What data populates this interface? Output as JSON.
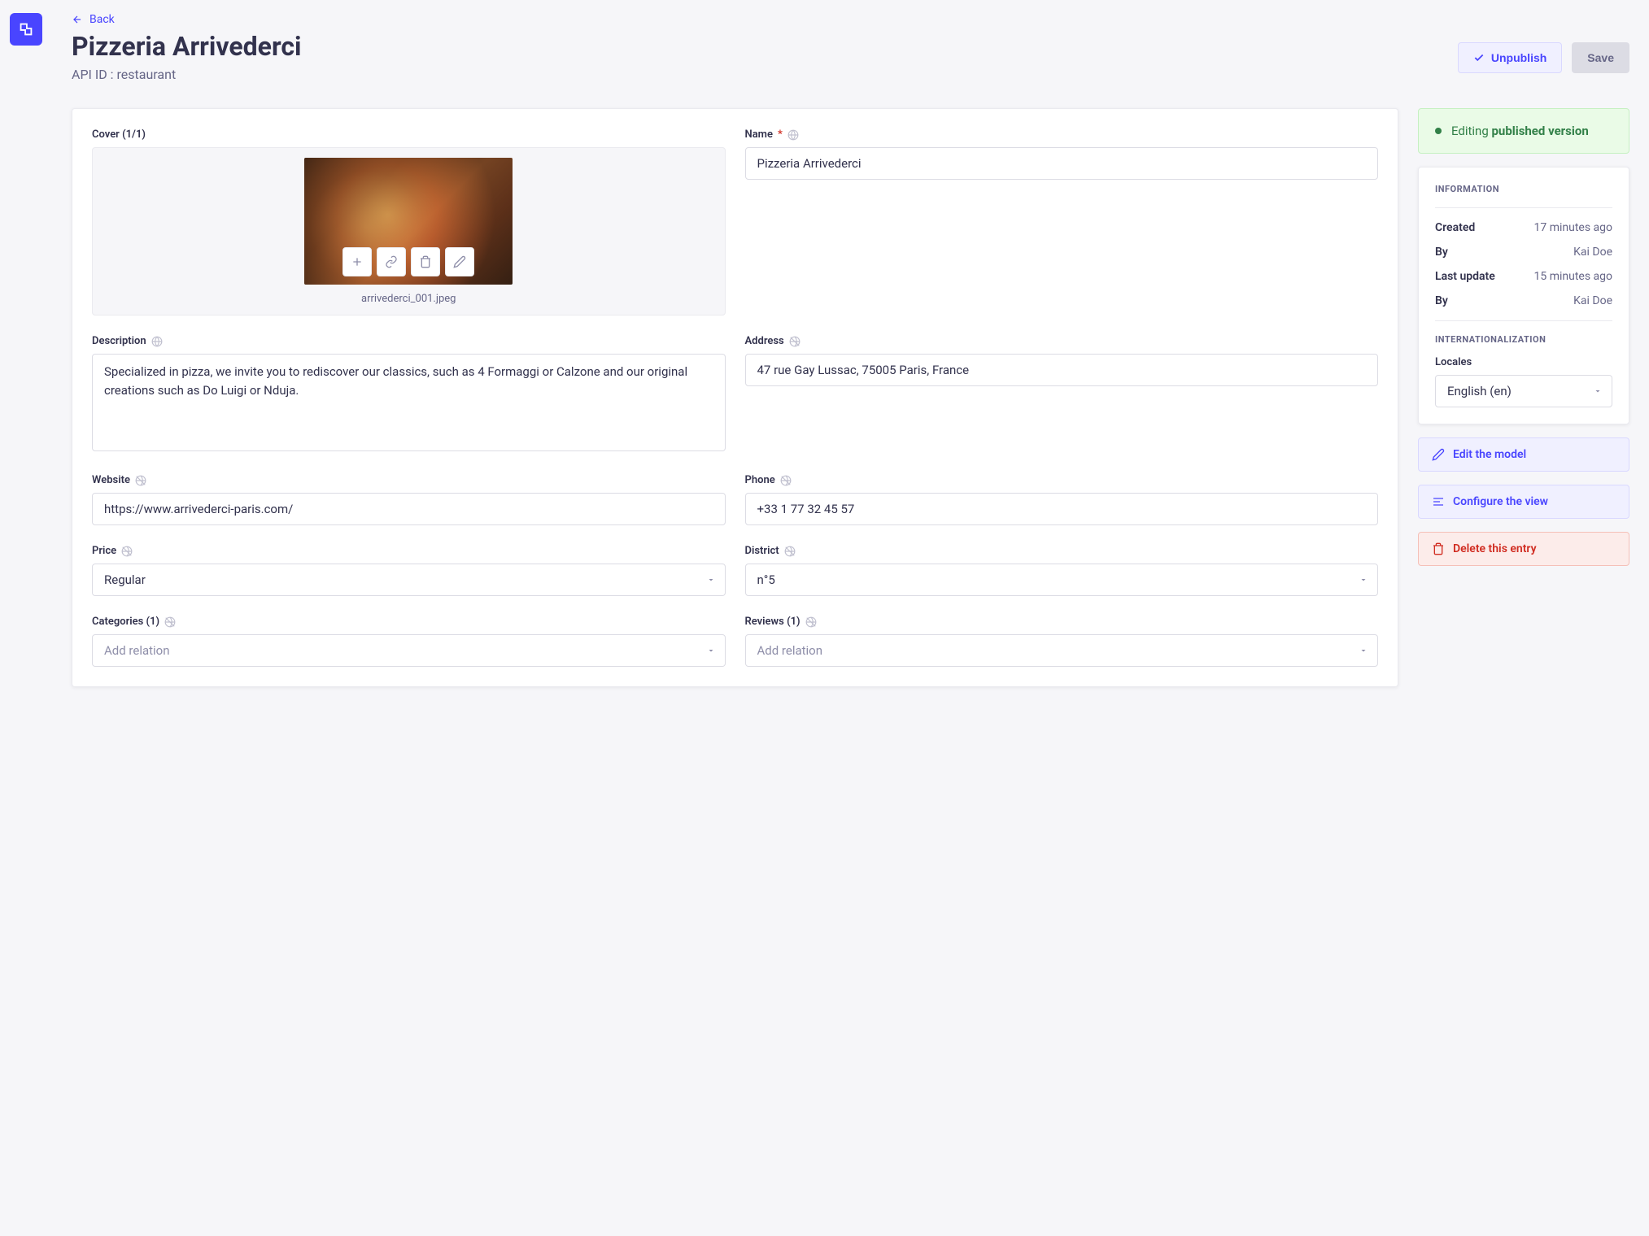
{
  "header": {
    "back": "Back",
    "title": "Pizzeria Arrivederci",
    "subtitle": "API ID : restaurant",
    "unpublish": "Unpublish",
    "save": "Save"
  },
  "fields": {
    "cover": {
      "label": "Cover (1/1)",
      "filename": "arrivederci_001.jpeg"
    },
    "name": {
      "label": "Name",
      "value": "Pizzeria Arrivederci"
    },
    "description": {
      "label": "Description",
      "value": "Specialized in pizza, we invite you to rediscover our classics, such as 4 Formaggi or Calzone and our original creations such as Do Luigi or Nduja."
    },
    "address": {
      "label": "Address",
      "value": "47 rue Gay Lussac, 75005 Paris, France"
    },
    "website": {
      "label": "Website",
      "value": "https://www.arrivederci-paris.com/"
    },
    "phone": {
      "label": "Phone",
      "value": "+33 1 77 32 45 57"
    },
    "price": {
      "label": "Price",
      "value": "Regular"
    },
    "district": {
      "label": "District",
      "value": "n°5"
    },
    "categories": {
      "label": "Categories (1)",
      "placeholder": "Add relation"
    },
    "reviews": {
      "label": "Reviews (1)",
      "placeholder": "Add relation"
    }
  },
  "status": {
    "prefix": "Editing ",
    "strong": "published version"
  },
  "info": {
    "heading": "INFORMATION",
    "created_label": "Created",
    "created_value": "17 minutes ago",
    "by_label": "By",
    "created_by": "Kai Doe",
    "update_label": "Last update",
    "update_value": "15 minutes ago",
    "updated_by": "Kai Doe"
  },
  "i18n": {
    "heading": "INTERNATIONALIZATION",
    "locales_label": "Locales",
    "locale_value": "English (en)"
  },
  "actions": {
    "edit_model": "Edit the model",
    "configure_view": "Configure the view",
    "delete_entry": "Delete this entry"
  }
}
